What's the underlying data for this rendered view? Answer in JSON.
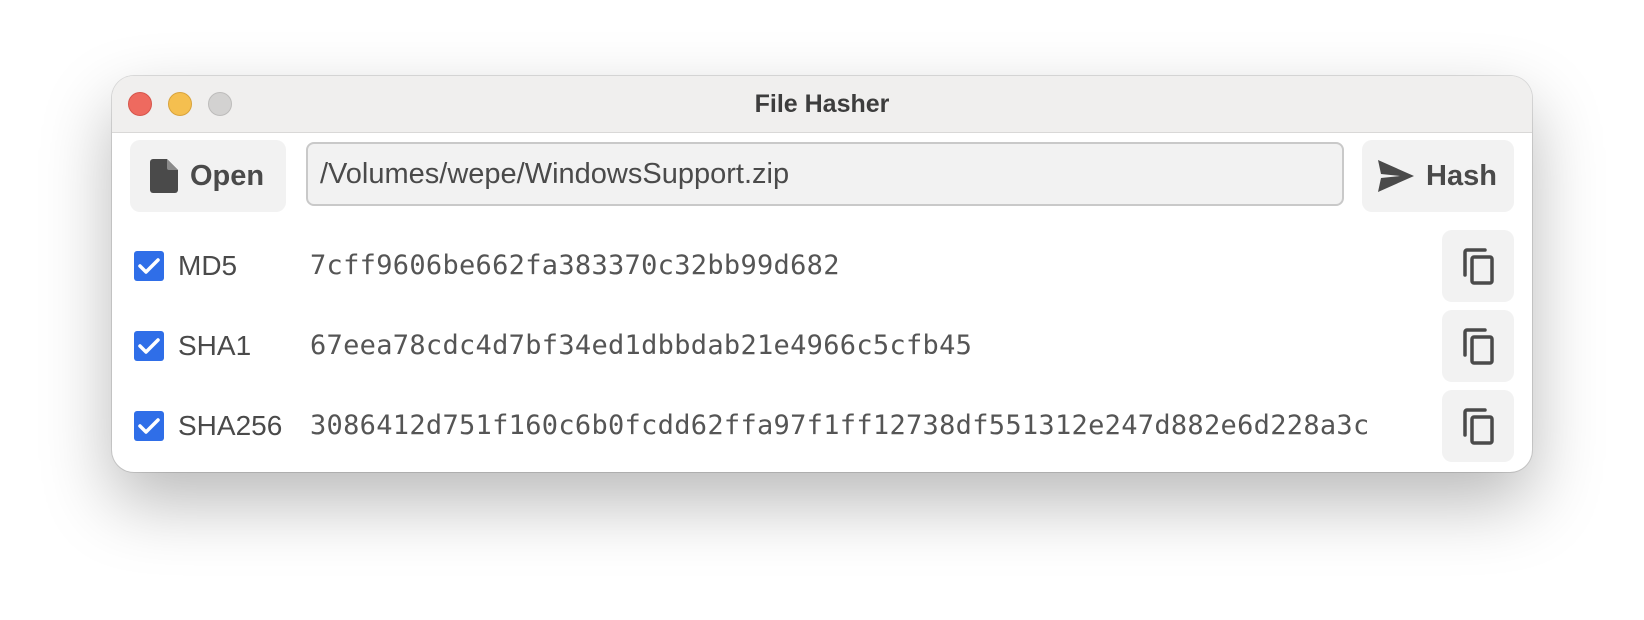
{
  "window": {
    "title": "File Hasher"
  },
  "toolbar": {
    "open_label": "Open",
    "open_icon": "file-icon",
    "path_value": "/Volumes/wepe/WindowsSupport.zip",
    "hash_label": "Hash",
    "hash_icon": "send-icon"
  },
  "hashes": [
    {
      "algorithm": "MD5",
      "checked": true,
      "value": "7cff9606be662fa383370c32bb99d682",
      "copy_icon": "copy-icon"
    },
    {
      "algorithm": "SHA1",
      "checked": true,
      "value": "67eea78cdc4d7bf34ed1dbbdab21e4966c5cfb45",
      "copy_icon": "copy-icon"
    },
    {
      "algorithm": "SHA256",
      "checked": true,
      "value": "3086412d751f160c6b0fcdd62ffa97f1ff12738df551312e247d882e6d228a3c",
      "copy_icon": "copy-icon"
    }
  ],
  "colors": {
    "checkbox_accent": "#2f6ee8",
    "close": "#ee6a5f",
    "minimize": "#f5bf4f",
    "maximize_disabled": "#d3d2d1"
  }
}
